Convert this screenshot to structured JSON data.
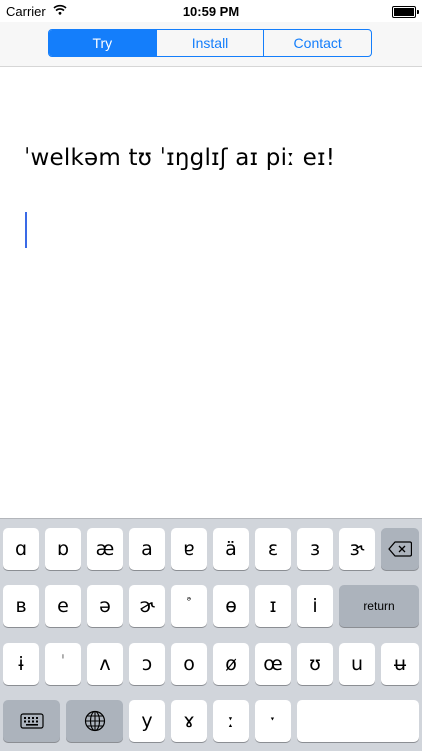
{
  "status_bar": {
    "carrier": "Carrier",
    "time": "10:59 PM",
    "wifi_icon": "wifi-icon",
    "battery_icon": "battery-icon"
  },
  "segmented_control": {
    "selected_index": 0,
    "segments": [
      {
        "label": "Try"
      },
      {
        "label": "Install"
      },
      {
        "label": "Contact"
      }
    ]
  },
  "editor": {
    "text": "ˈwelkəm tʊ ˈɪŋglɪʃ aɪ piː eɪ!"
  },
  "keyboard": {
    "row1": [
      "ɑ",
      "ɒ",
      "æ",
      "a",
      "ɐ",
      "ä",
      "ɛ",
      "ɜ",
      "ɝ"
    ],
    "row1_delete_icon": "backspace-icon",
    "row2": [
      "ʙ",
      "e",
      "ə",
      "ɚ",
      "ᵊ",
      "ɵ",
      "ɪ",
      "i"
    ],
    "row2_return": "return",
    "row3": [
      "ɨ",
      "ⁱ",
      "ʌ",
      "ɔ",
      "o",
      "ø",
      "œ",
      "ʊ",
      "u",
      "ʉ"
    ],
    "row4": {
      "keyboard_icon": "keyboard-icon",
      "globe_icon": "globe-icon",
      "keys": [
        "y",
        "ɤ",
        "ː",
        "ˑ"
      ]
    }
  },
  "colors": {
    "accent": "#147efb",
    "keyboard_bg": "#d1d5db",
    "key_dark": "#acb3bc",
    "caret": "#3a6ae6"
  }
}
